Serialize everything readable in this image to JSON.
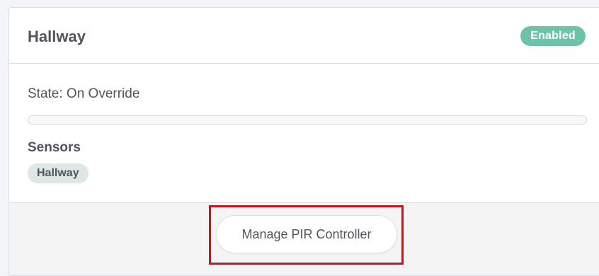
{
  "card": {
    "title": "Hallway",
    "status_badge": "Enabled",
    "state_text": "State: On Override",
    "progress": 0,
    "sensors_heading": "Sensors",
    "sensors": [
      "Hallway"
    ]
  },
  "footer": {
    "manage_button_label": "Manage PIR Controller"
  },
  "colors": {
    "accent_green": "#6dc3a5",
    "highlight_red": "#c4161c",
    "text": "#50555e"
  }
}
